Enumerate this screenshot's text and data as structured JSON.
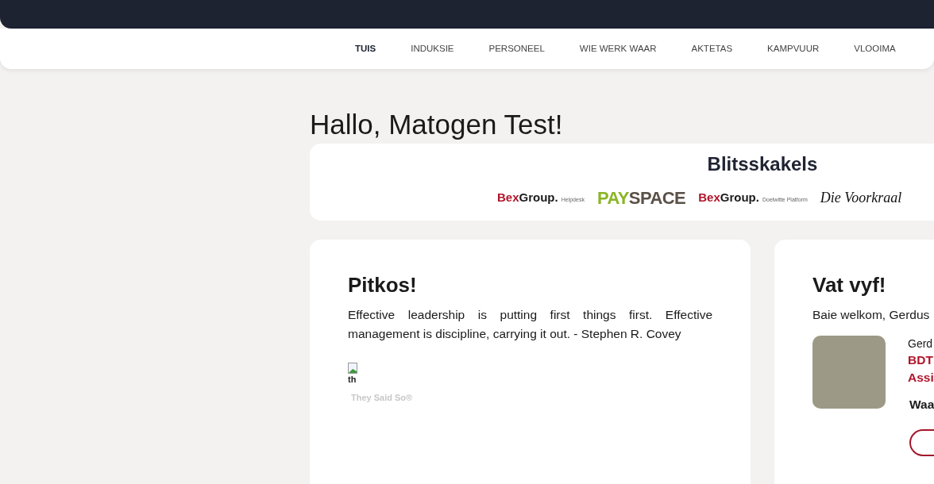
{
  "nav": [
    {
      "label": "TUIS",
      "selected": true
    },
    {
      "label": "INDUKSIE",
      "selected": false
    },
    {
      "label": "PERSONEEL",
      "selected": false
    },
    {
      "label": "WIE WERK WAAR",
      "selected": false
    },
    {
      "label": "AKTETAS",
      "selected": false
    },
    {
      "label": "KAMPVUUR",
      "selected": false
    },
    {
      "label": "VLOOIMA",
      "selected": false
    }
  ],
  "greeting": "Hallo, Matogen Test!",
  "quick_links": {
    "title": "Blitsskakels",
    "links": [
      {
        "kind": "bexgroup",
        "brand_a": "Bex",
        "brand_b": "Group.",
        "suffix": "Helpdesk"
      },
      {
        "kind": "payspace",
        "brand_a": "PAY",
        "brand_b": "SPACE"
      },
      {
        "kind": "bexgroup",
        "brand_a": "Bex",
        "brand_b": "Group.",
        "suffix": "Doelwitte Platform"
      },
      {
        "kind": "script",
        "brand_a": "Die Voorkraal"
      }
    ]
  },
  "quote_card": {
    "title": "Pitkos!",
    "quote": "Effective leadership is putting first things first. Effective management is discipline, carrying it out. - Stephen R. Covey",
    "image_alt": "th",
    "credit": "They Said So®"
  },
  "welcome_card": {
    "title": "Vat vyf!",
    "greeting": "Baie welkom, Gerdus",
    "name": "Gerd",
    "role_lines": [
      "BDT",
      "Assi"
    ],
    "label": "Waa"
  }
}
